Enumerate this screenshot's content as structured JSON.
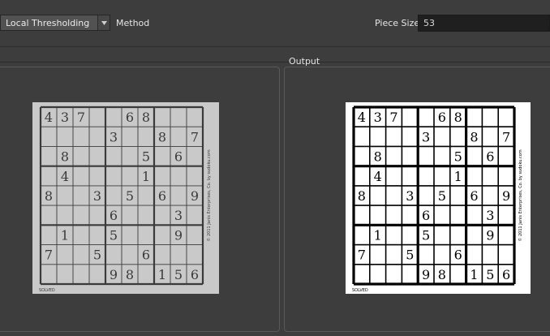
{
  "toolbar": {
    "method_value": "Local Thresholding",
    "method_label": "Method",
    "piece_size_label": "Piece Size",
    "piece_size_value": "53"
  },
  "output_section": {
    "label": "Output"
  },
  "sudoku": {
    "grid": [
      [
        "4",
        "3",
        "7",
        "",
        "",
        "6",
        "8",
        "",
        "",
        ""
      ],
      [
        "",
        "",
        "",
        "",
        "3",
        "",
        "",
        "8",
        "",
        "7"
      ],
      [
        "",
        "8",
        "",
        "",
        "",
        "",
        "5",
        "",
        "6",
        ""
      ],
      [
        "",
        "4",
        "",
        "",
        "",
        "",
        "1",
        "",
        "",
        ""
      ],
      [
        "8",
        "",
        "",
        "3",
        "",
        "5",
        "",
        "6",
        "",
        "9"
      ],
      [
        "",
        "",
        "",
        "",
        "6",
        "",
        "",
        "",
        "3",
        ""
      ],
      [
        "",
        "1",
        "",
        "",
        "5",
        "",
        "",
        "",
        "9",
        ""
      ],
      [
        "7",
        "",
        "",
        "5",
        "",
        "",
        "6",
        "",
        "",
        ""
      ],
      [
        "",
        "",
        "",
        "",
        "9",
        "8",
        "",
        "1",
        "5",
        "6"
      ]
    ],
    "margin_text": "© 2011 Janis Enterprises, Co. by sudoku.com",
    "footer_text": "SOLVED"
  },
  "colors": {
    "input_paper": "#c9c9c9",
    "input_ink": "#3a3a3a",
    "output_paper": "#ffffff",
    "output_ink": "#000000"
  }
}
